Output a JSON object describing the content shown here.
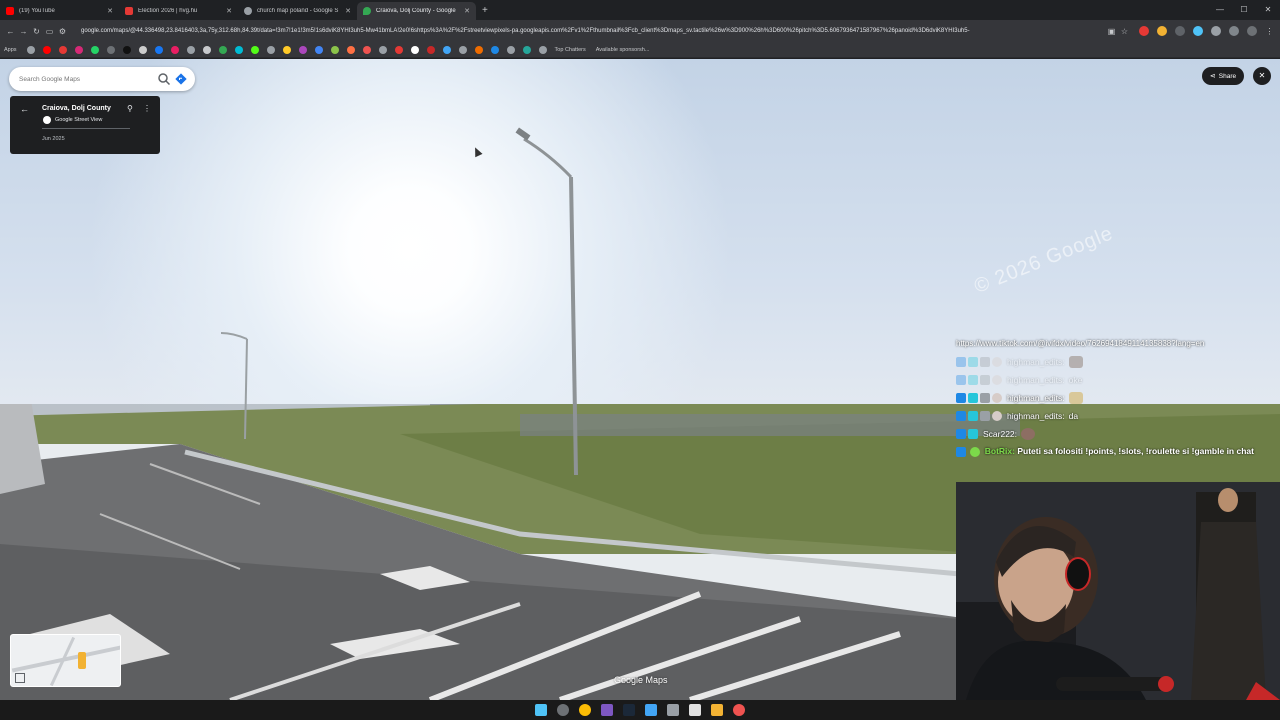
{
  "browser": {
    "tabs": [
      {
        "label": "(19) YouTube",
        "color": "#ff0000"
      },
      {
        "label": "Election 2026 | hvg.hu",
        "color": "#e53935"
      },
      {
        "label": "church map poland - Google S",
        "color": "#9aa0a6"
      },
      {
        "label": "Craiova, Dolj County - Google",
        "color": "#34a853"
      }
    ],
    "url": "google.com/maps/@44.336498,23.8416403,3a,75y,312.68h,84.39t/data=!3m7!1e1!3m5!1s6dviK8YHI3uh5-Mw41bmLA!2e0!6shttps%3A%2F%2Fstreetviewpixels-pa.googleapis.com%2Fv1%2Fthumbnail%3Fcb_client%3Dmaps_sv.tactile%26w%3D900%26h%3D600%26pitch%3D5.6067936471587967%26panoid%3D6dviK8YHI3uh5-",
    "bookmarks": {
      "apps_label": "Apps",
      "top_chatters": "Top Chatters",
      "available": "Available sponsorsh..."
    }
  },
  "maps": {
    "search_placeholder": "Search Google Maps",
    "place_title": "Craiova, Dolj County",
    "provider": "Google Street View",
    "date": "Jun 2025",
    "share_label": "Share",
    "watermark": "© 2026 Google",
    "logo": "Google Maps"
  },
  "chat": {
    "url_line": "https://www.tiktok.com/@ivifdx/video/7626941849114135838?lang=en",
    "messages": [
      {
        "user": "highman_edits:",
        "text": "",
        "emote": true,
        "dim": true
      },
      {
        "user": "highman_edits:",
        "text": "oke",
        "emote": false,
        "dim": true
      },
      {
        "user": "highman_edits:",
        "text": "",
        "emote": true,
        "dim": false
      },
      {
        "user": "highman_edits:",
        "text": "da",
        "emote": false,
        "dim": false
      },
      {
        "user": "Scar222:",
        "text": "",
        "emote": true,
        "dim": false
      }
    ],
    "bot": {
      "user": "BotRix:",
      "text": "Puteti sa folositi !points, !slots, !roulette si !gamble in chat",
      "color": "#7cd94a"
    }
  },
  "colors": {
    "accent": "#1a73e8",
    "dark_panel": "#1e1f21"
  }
}
